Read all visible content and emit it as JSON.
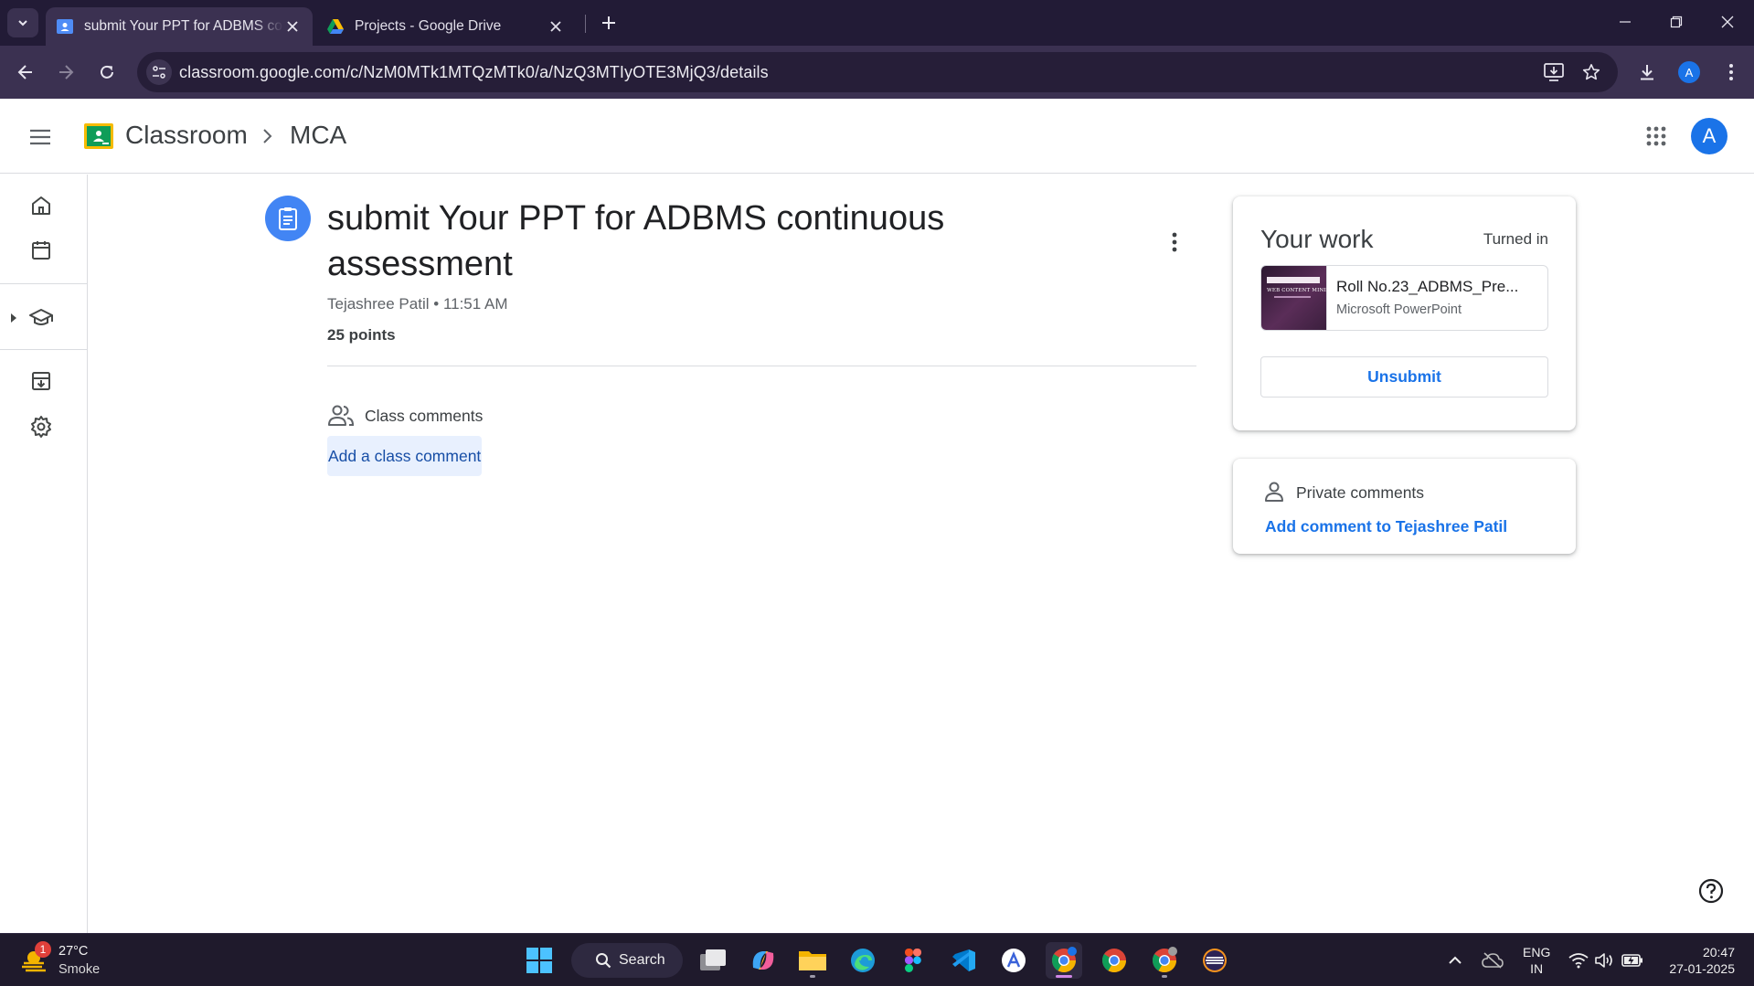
{
  "browser": {
    "tabs": [
      {
        "title": "submit Your PPT for ADBMS continuous assessment",
        "active": true
      },
      {
        "title": "Projects - Google Drive",
        "active": false
      }
    ],
    "url": "classroom.google.com/c/NzM0MTk1MTQzMTk0/a/NzQ3MTIyOTE3MjQ3/details",
    "profile_initial": "A"
  },
  "header": {
    "app_name": "Classroom",
    "class_name": "MCA",
    "avatar_initial": "A"
  },
  "assignment": {
    "title": "submit Your PPT for ADBMS continuous assessment",
    "author": "Tejashree Patil",
    "time": "11:51 AM",
    "points": "25 points"
  },
  "class_comments": {
    "label": "Class comments",
    "add_label": "Add a class comment"
  },
  "your_work": {
    "title": "Your work",
    "status": "Turned in",
    "attachment": {
      "name": "Roll No.23_ADBMS_Pre...",
      "type": "Microsoft PowerPoint",
      "thumb_text": "WEB CONTENT MINING"
    },
    "unsubmit_label": "Unsubmit"
  },
  "private_comments": {
    "label": "Private comments",
    "add_label": "Add comment to Tejashree Patil"
  },
  "taskbar": {
    "weather_temp": "27°C",
    "weather_desc": "Smoke",
    "weather_badge": "1",
    "search_label": "Search",
    "lang_line1": "ENG",
    "lang_line2": "IN",
    "time": "20:47",
    "date": "27-01-2025"
  },
  "colors": {
    "accent": "#1a73e8",
    "chrome_dark": "#221b36",
    "chrome_toolbar": "#3b3151",
    "classroom_green": "#0f9d58",
    "assignment_icon": "#4285f4"
  }
}
